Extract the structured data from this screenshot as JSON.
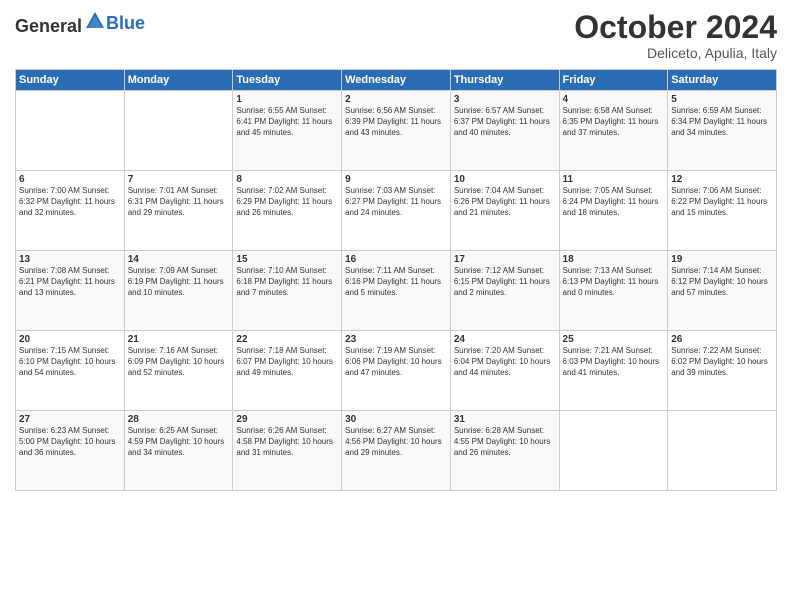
{
  "header": {
    "logo_general": "General",
    "logo_blue": "Blue",
    "month": "October 2024",
    "location": "Deliceto, Apulia, Italy"
  },
  "days_of_week": [
    "Sunday",
    "Monday",
    "Tuesday",
    "Wednesday",
    "Thursday",
    "Friday",
    "Saturday"
  ],
  "weeks": [
    [
      {
        "day": "",
        "info": ""
      },
      {
        "day": "",
        "info": ""
      },
      {
        "day": "1",
        "info": "Sunrise: 6:55 AM\nSunset: 6:41 PM\nDaylight: 11 hours and 45 minutes."
      },
      {
        "day": "2",
        "info": "Sunrise: 6:56 AM\nSunset: 6:39 PM\nDaylight: 11 hours and 43 minutes."
      },
      {
        "day": "3",
        "info": "Sunrise: 6:57 AM\nSunset: 6:37 PM\nDaylight: 11 hours and 40 minutes."
      },
      {
        "day": "4",
        "info": "Sunrise: 6:58 AM\nSunset: 6:35 PM\nDaylight: 11 hours and 37 minutes."
      },
      {
        "day": "5",
        "info": "Sunrise: 6:59 AM\nSunset: 6:34 PM\nDaylight: 11 hours and 34 minutes."
      }
    ],
    [
      {
        "day": "6",
        "info": "Sunrise: 7:00 AM\nSunset: 6:32 PM\nDaylight: 11 hours and 32 minutes."
      },
      {
        "day": "7",
        "info": "Sunrise: 7:01 AM\nSunset: 6:31 PM\nDaylight: 11 hours and 29 minutes."
      },
      {
        "day": "8",
        "info": "Sunrise: 7:02 AM\nSunset: 6:29 PM\nDaylight: 11 hours and 26 minutes."
      },
      {
        "day": "9",
        "info": "Sunrise: 7:03 AM\nSunset: 6:27 PM\nDaylight: 11 hours and 24 minutes."
      },
      {
        "day": "10",
        "info": "Sunrise: 7:04 AM\nSunset: 6:26 PM\nDaylight: 11 hours and 21 minutes."
      },
      {
        "day": "11",
        "info": "Sunrise: 7:05 AM\nSunset: 6:24 PM\nDaylight: 11 hours and 18 minutes."
      },
      {
        "day": "12",
        "info": "Sunrise: 7:06 AM\nSunset: 6:22 PM\nDaylight: 11 hours and 15 minutes."
      }
    ],
    [
      {
        "day": "13",
        "info": "Sunrise: 7:08 AM\nSunset: 6:21 PM\nDaylight: 11 hours and 13 minutes."
      },
      {
        "day": "14",
        "info": "Sunrise: 7:09 AM\nSunset: 6:19 PM\nDaylight: 11 hours and 10 minutes."
      },
      {
        "day": "15",
        "info": "Sunrise: 7:10 AM\nSunset: 6:18 PM\nDaylight: 11 hours and 7 minutes."
      },
      {
        "day": "16",
        "info": "Sunrise: 7:11 AM\nSunset: 6:16 PM\nDaylight: 11 hours and 5 minutes."
      },
      {
        "day": "17",
        "info": "Sunrise: 7:12 AM\nSunset: 6:15 PM\nDaylight: 11 hours and 2 minutes."
      },
      {
        "day": "18",
        "info": "Sunrise: 7:13 AM\nSunset: 6:13 PM\nDaylight: 11 hours and 0 minutes."
      },
      {
        "day": "19",
        "info": "Sunrise: 7:14 AM\nSunset: 6:12 PM\nDaylight: 10 hours and 57 minutes."
      }
    ],
    [
      {
        "day": "20",
        "info": "Sunrise: 7:15 AM\nSunset: 6:10 PM\nDaylight: 10 hours and 54 minutes."
      },
      {
        "day": "21",
        "info": "Sunrise: 7:16 AM\nSunset: 6:09 PM\nDaylight: 10 hours and 52 minutes."
      },
      {
        "day": "22",
        "info": "Sunrise: 7:18 AM\nSunset: 6:07 PM\nDaylight: 10 hours and 49 minutes."
      },
      {
        "day": "23",
        "info": "Sunrise: 7:19 AM\nSunset: 6:06 PM\nDaylight: 10 hours and 47 minutes."
      },
      {
        "day": "24",
        "info": "Sunrise: 7:20 AM\nSunset: 6:04 PM\nDaylight: 10 hours and 44 minutes."
      },
      {
        "day": "25",
        "info": "Sunrise: 7:21 AM\nSunset: 6:03 PM\nDaylight: 10 hours and 41 minutes."
      },
      {
        "day": "26",
        "info": "Sunrise: 7:22 AM\nSunset: 6:02 PM\nDaylight: 10 hours and 39 minutes."
      }
    ],
    [
      {
        "day": "27",
        "info": "Sunrise: 6:23 AM\nSunset: 5:00 PM\nDaylight: 10 hours and 36 minutes."
      },
      {
        "day": "28",
        "info": "Sunrise: 6:25 AM\nSunset: 4:59 PM\nDaylight: 10 hours and 34 minutes."
      },
      {
        "day": "29",
        "info": "Sunrise: 6:26 AM\nSunset: 4:58 PM\nDaylight: 10 hours and 31 minutes."
      },
      {
        "day": "30",
        "info": "Sunrise: 6:27 AM\nSunset: 4:56 PM\nDaylight: 10 hours and 29 minutes."
      },
      {
        "day": "31",
        "info": "Sunrise: 6:28 AM\nSunset: 4:55 PM\nDaylight: 10 hours and 26 minutes."
      },
      {
        "day": "",
        "info": ""
      },
      {
        "day": "",
        "info": ""
      }
    ]
  ]
}
